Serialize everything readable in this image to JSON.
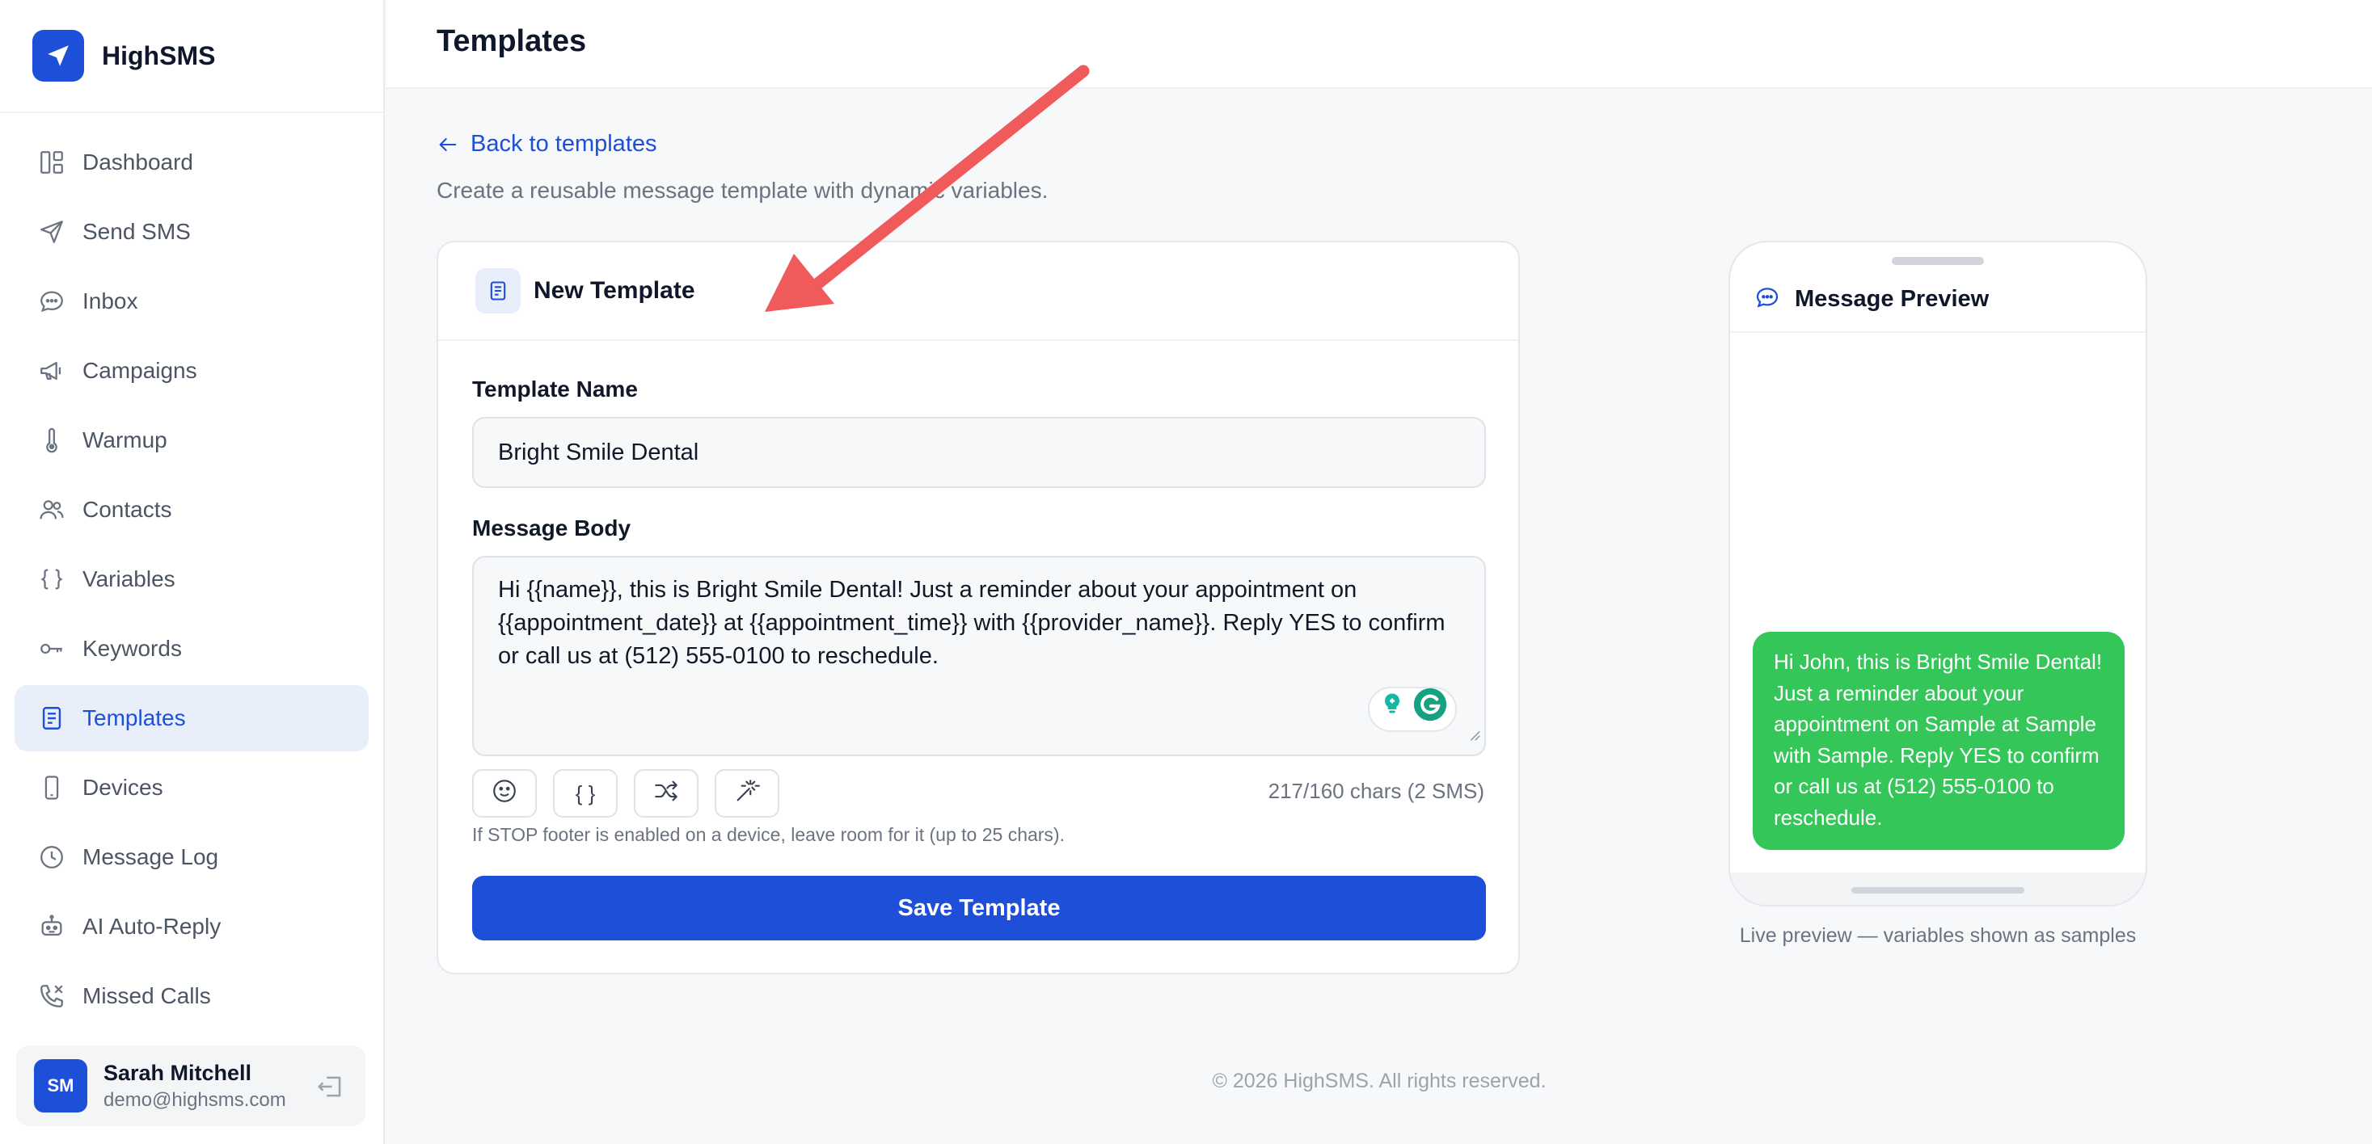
{
  "brand": {
    "name": "HighSMS",
    "accent": "#1d4fd8"
  },
  "sidebar": {
    "items": [
      {
        "label": "Dashboard",
        "icon": "dashboard-icon",
        "active": false
      },
      {
        "label": "Send SMS",
        "icon": "send-icon",
        "active": false
      },
      {
        "label": "Inbox",
        "icon": "chat-icon",
        "active": false
      },
      {
        "label": "Campaigns",
        "icon": "megaphone-icon",
        "active": false
      },
      {
        "label": "Warmup",
        "icon": "thermometer-icon",
        "active": false
      },
      {
        "label": "Contacts",
        "icon": "users-icon",
        "active": false
      },
      {
        "label": "Variables",
        "icon": "braces-icon",
        "active": false
      },
      {
        "label": "Keywords",
        "icon": "key-icon",
        "active": false
      },
      {
        "label": "Templates",
        "icon": "document-icon",
        "active": true
      },
      {
        "label": "Devices",
        "icon": "smartphone-icon",
        "active": false
      },
      {
        "label": "Message Log",
        "icon": "clock-icon",
        "active": false
      },
      {
        "label": "AI Auto-Reply",
        "icon": "robot-icon",
        "active": false
      },
      {
        "label": "Missed Calls",
        "icon": "phone-missed-icon",
        "active": false
      }
    ]
  },
  "user": {
    "initials": "SM",
    "name": "Sarah Mitchell",
    "email": "demo@highsms.com"
  },
  "header": {
    "title": "Templates"
  },
  "main": {
    "back_link": "Back to templates",
    "subtitle": "Create a reusable message template with dynamic variables.",
    "form": {
      "title": "New Template",
      "name_label": "Template Name",
      "name_value": "Bright Smile Dental",
      "body_label": "Message Body",
      "body_value": "Hi {{name}}, this is Bright Smile Dental! Just a reminder about your appointment on {{appointment_date}} at {{appointment_time}} with {{provider_name}}. Reply YES to confirm or call us at (512) 555-0100 to reschedule.",
      "char_count": "217/160 chars (2 SMS)",
      "hint": "If STOP footer is enabled on a device, leave room for it (up to 25 chars).",
      "save_label": "Save Template"
    },
    "tools": {
      "braces": "{ }"
    }
  },
  "preview": {
    "title": "Message Preview",
    "message": "Hi John, this is Bright Smile Dental! Just a reminder about your appointment on Sample at Sample with Sample. Reply YES to confirm or call us at (512) 555-0100 to reschedule.",
    "caption": "Live preview — variables shown as samples",
    "bubble_color": "#35c65a"
  },
  "footer": {
    "text": "© 2026 HighSMS. All rights reserved."
  },
  "annotation": {
    "color": "#f05a5a"
  }
}
